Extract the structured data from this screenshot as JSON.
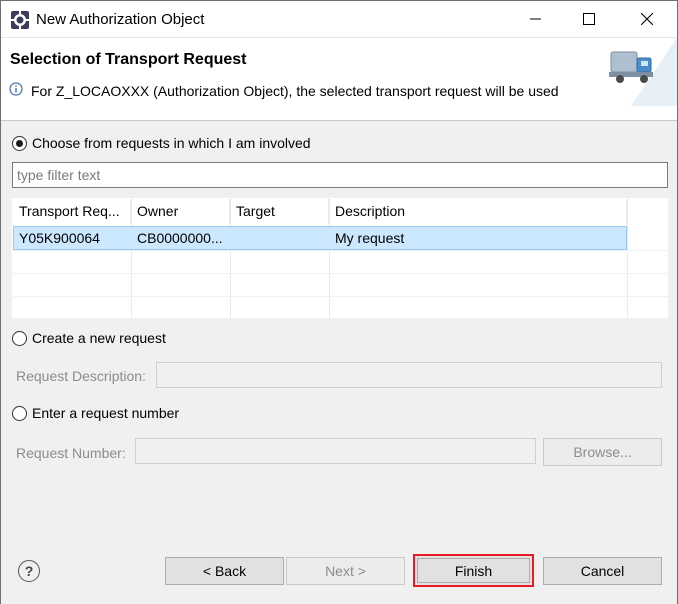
{
  "window": {
    "title": "New Authorization Object",
    "controls": {
      "minimize": "minimize",
      "maximize": "maximize",
      "close": "close"
    }
  },
  "header": {
    "title": "Selection of Transport Request",
    "message": "For Z_LOCAOXXX (Authorization Object), the selected transport request will be used",
    "icon": "truck-icon"
  },
  "options": {
    "choose": {
      "label": "Choose from requests in which I am involved",
      "checked": true
    },
    "filter": {
      "placeholder": "type filter text",
      "value": ""
    },
    "create": {
      "label": "Create a new request",
      "checked": false
    },
    "enter": {
      "label": "Enter a request number",
      "checked": false
    }
  },
  "table": {
    "columns": [
      "Transport Req...",
      "Owner",
      "Target",
      "Description"
    ],
    "rows": [
      {
        "transport_request": "Y05K900064",
        "owner": "CB0000000...",
        "target": "",
        "description": "My request",
        "selected": true
      }
    ]
  },
  "request_description": {
    "label": "Request Description:",
    "value": ""
  },
  "request_number": {
    "label": "Request Number:",
    "value": "",
    "browse_label": "Browse..."
  },
  "footer": {
    "back_label": "< Back",
    "next_label": "Next >",
    "finish_label": "Finish",
    "cancel_label": "Cancel"
  },
  "colors": {
    "selection": "#cce8ff",
    "highlight_border": "#e81c24"
  }
}
